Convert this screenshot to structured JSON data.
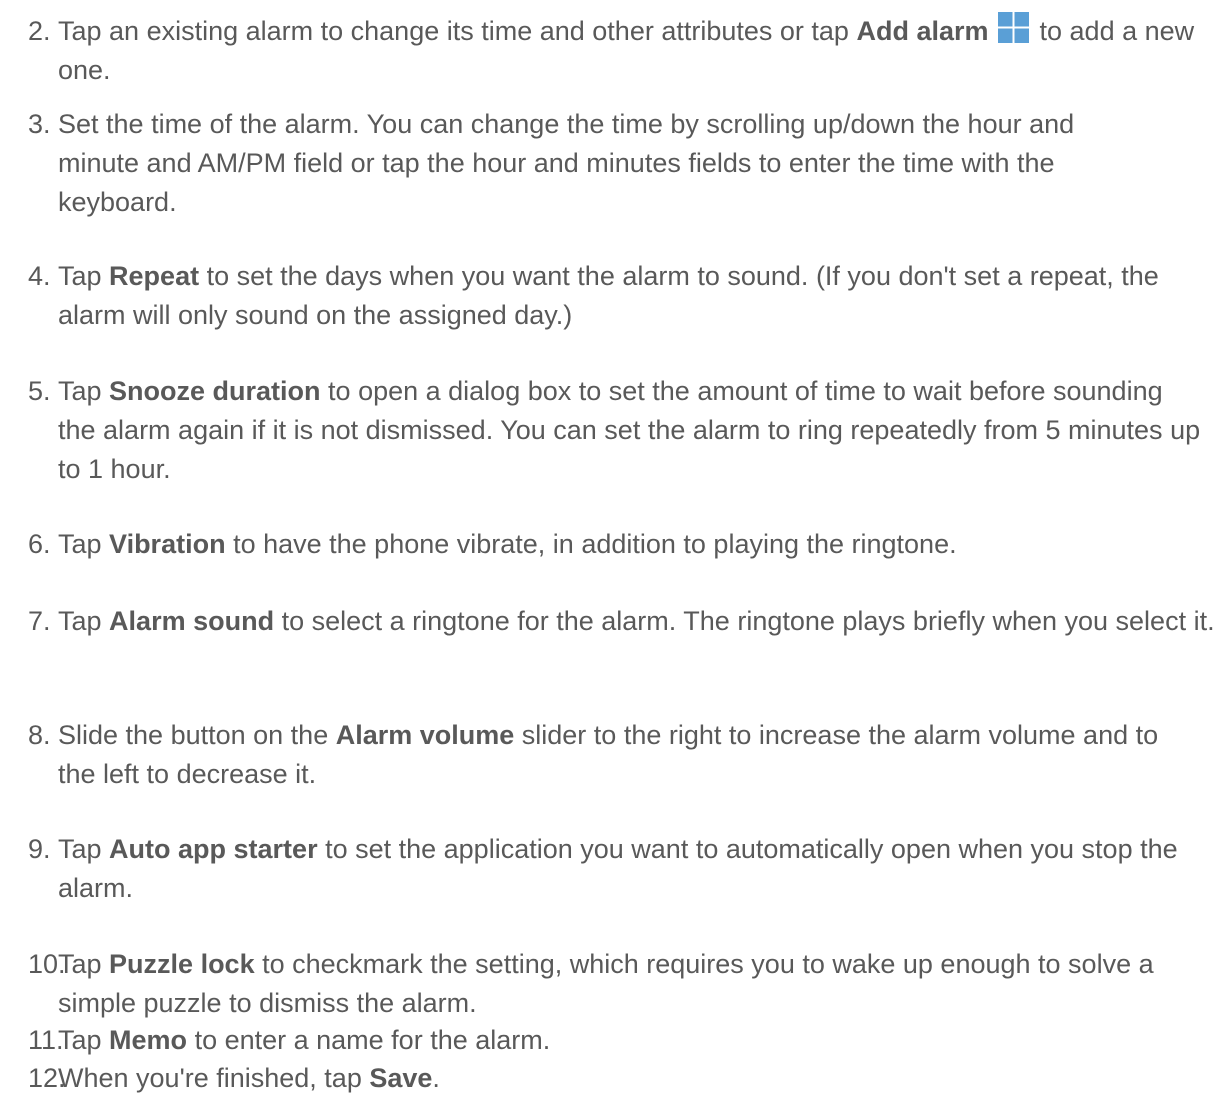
{
  "steps": [
    {
      "number": "2.",
      "parts": [
        {
          "t": "text",
          "v": "Tap an existing alarm to change its time and other attributes or tap "
        },
        {
          "t": "bold",
          "v": "Add alarm"
        },
        {
          "t": "text",
          "v": " "
        },
        {
          "t": "icon",
          "icon": "add-alarm-icon"
        },
        {
          "t": "text",
          "v": " to add a new one."
        }
      ]
    },
    {
      "number": "3.",
      "parts": [
        {
          "t": "text",
          "v": "Set the time of the alarm. You can change the time by scrolling up/down the hour and minute and AM/PM field or tap the hour and minutes fields to enter the time with the keyboard."
        }
      ]
    },
    {
      "number": "4.",
      "parts": [
        {
          "t": "text",
          "v": "Tap "
        },
        {
          "t": "bold",
          "v": "Repeat"
        },
        {
          "t": "text",
          "v": " to set the days when you want the alarm to sound. (If you don't set a repeat, the alarm will only sound on the assigned day.)"
        }
      ]
    },
    {
      "number": "5.",
      "parts": [
        {
          "t": "text",
          "v": "Tap "
        },
        {
          "t": "bold",
          "v": "Snooze duration"
        },
        {
          "t": "text",
          "v": " to open a dialog box to set the amount of time to wait before sounding the alarm again if it is not dismissed. You can set the alarm to ring repeatedly from 5 minutes up to 1 hour."
        }
      ]
    },
    {
      "number": "6.",
      "parts": [
        {
          "t": "text",
          "v": "Tap "
        },
        {
          "t": "bold",
          "v": "Vibration"
        },
        {
          "t": "text",
          "v": " to have the phone vibrate, in addition to playing the ringtone."
        }
      ]
    },
    {
      "number": "7.",
      "parts": [
        {
          "t": "text",
          "v": "Tap "
        },
        {
          "t": "bold",
          "v": "Alarm sound"
        },
        {
          "t": "text",
          "v": " to select a ringtone for the alarm. The ringtone plays briefly when you select it."
        }
      ]
    },
    {
      "number": "8.",
      "parts": [
        {
          "t": "text",
          "v": "Slide the button on the "
        },
        {
          "t": "bold",
          "v": "Alarm volume"
        },
        {
          "t": "text",
          "v": " slider to the right to increase the alarm volume and to the left to decrease it."
        }
      ]
    },
    {
      "number": "9.",
      "parts": [
        {
          "t": "text",
          "v": "Tap "
        },
        {
          "t": "bold",
          "v": "Auto app starter"
        },
        {
          "t": "text",
          "v": " to set the application you want to automatically open when you stop the alarm."
        }
      ]
    },
    {
      "number": "10.",
      "parts": [
        {
          "t": "text",
          "v": "Tap "
        },
        {
          "t": "bold",
          "v": "Puzzle lock"
        },
        {
          "t": "text",
          "v": " to checkmark the setting, which requires you to wake up enough to solve a simple puzzle to dismiss the alarm."
        }
      ]
    },
    {
      "number": "11.",
      "parts": [
        {
          "t": "text",
          "v": "Tap "
        },
        {
          "t": "bold",
          "v": "Memo"
        },
        {
          "t": "text",
          "v": " to enter a name for the alarm."
        }
      ]
    },
    {
      "number": "12.",
      "parts": [
        {
          "t": "text",
          "v": "When you're finished, tap "
        },
        {
          "t": "bold",
          "v": "Save"
        },
        {
          "t": "text",
          "v": "."
        }
      ]
    }
  ],
  "colors": {
    "text": "#595959",
    "icon_background": "#5a9fd6",
    "icon_lines": "#ffffff"
  }
}
